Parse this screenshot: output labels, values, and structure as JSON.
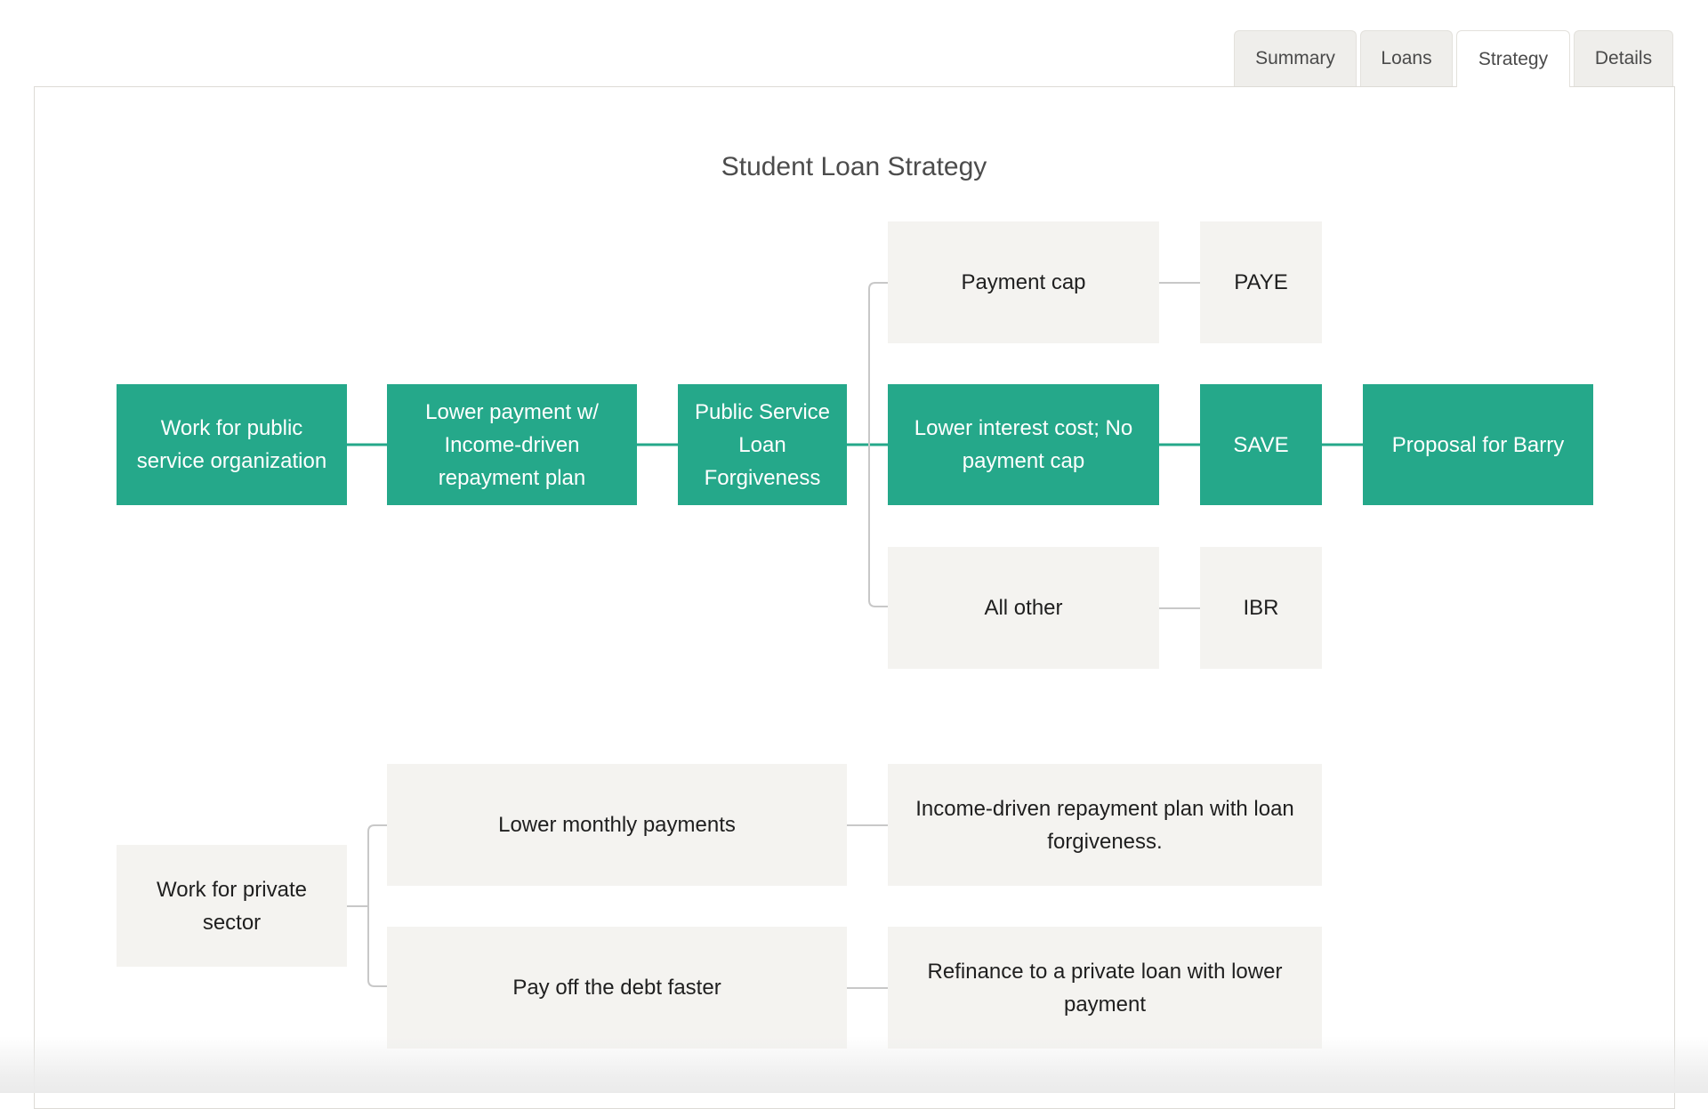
{
  "tabs": [
    {
      "label": "Summary",
      "active": false
    },
    {
      "label": "Loans",
      "active": false
    },
    {
      "label": "Strategy",
      "active": true
    },
    {
      "label": "Details",
      "active": false
    }
  ],
  "title": "Student Loan Strategy",
  "colors": {
    "accent_green": "#25a88a",
    "node_gray": "#f4f3f0",
    "connector_gray": "#c8c8c8"
  },
  "public_path": {
    "start": "Work for public service organization",
    "step": "Lower payment w/ Income-driven repayment plan",
    "program": "Public Service Loan Forgiveness",
    "options": [
      {
        "reason": "Payment cap",
        "plan": "PAYE",
        "selected": false
      },
      {
        "reason": "Lower interest cost; No payment cap",
        "plan": "SAVE",
        "selected": true
      },
      {
        "reason": "All other",
        "plan": "IBR",
        "selected": false
      }
    ],
    "proposal": "Proposal for Barry"
  },
  "private_path": {
    "start": "Work for private sector",
    "options": [
      {
        "goal": "Lower monthly payments",
        "action": "Income-driven repayment plan with loan forgiveness."
      },
      {
        "goal": "Pay off the debt faster",
        "action": "Refinance to a private loan with lower payment"
      }
    ]
  }
}
